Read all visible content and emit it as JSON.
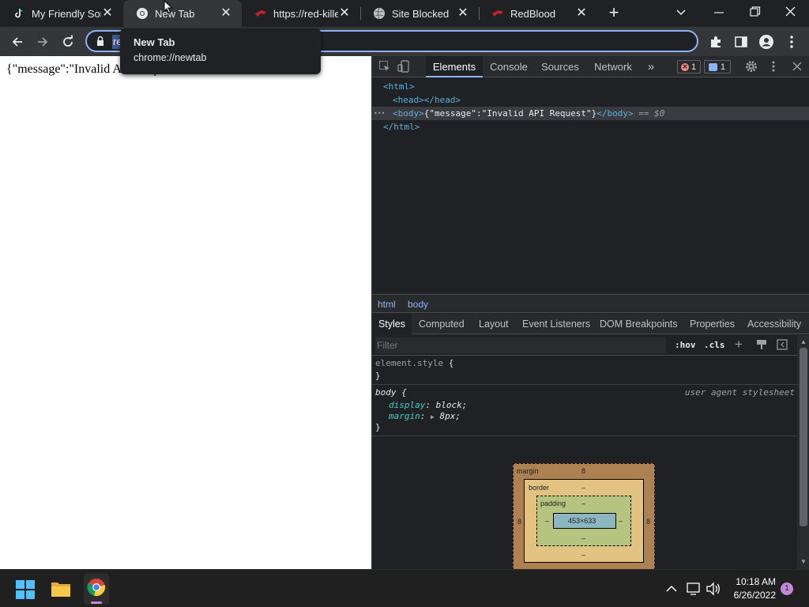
{
  "tabs": [
    {
      "title": "My Friendly Sonnet",
      "icon": "tiktok-icon",
      "active": false
    },
    {
      "title": "New Tab",
      "icon": "chrome-icon",
      "active": true
    },
    {
      "title": "https://red-killer.cab",
      "icon": "redblood-icon",
      "active": false
    },
    {
      "title": "Site Blocked",
      "icon": "globe-icon",
      "active": false
    },
    {
      "title": "RedBlood",
      "icon": "redblood-icon",
      "active": false
    }
  ],
  "new_tab_label": "+",
  "omnibox": {
    "visible_text": "re"
  },
  "tooltip": {
    "title": "New Tab",
    "url": "chrome://newtab"
  },
  "page": {
    "body_text": "{\"message\":\"Invalid API Request\"}"
  },
  "devtools": {
    "tabs": [
      "Elements",
      "Console",
      "Sources",
      "Network"
    ],
    "more_label": "»",
    "error_count": "1",
    "message_count": "1",
    "dom": {
      "html_open": "<html>",
      "head": "<head></head>",
      "body_open": "<body>",
      "body_text": "{\"message\":\"Invalid API Request\"}",
      "body_close": "</body>",
      "eq": "== $0",
      "html_close": "</html>",
      "ellipsis": "•••"
    },
    "breadcrumbs": [
      "html",
      "body"
    ],
    "subtabs": [
      "Styles",
      "Computed",
      "Layout",
      "Event Listeners",
      "DOM Breakpoints",
      "Properties",
      "Accessibility"
    ],
    "filter_placeholder": "Filter",
    "hov": ":hov",
    "cls": ".cls",
    "plus": "+",
    "element_style_selector": "element.style",
    "brace_open": "{",
    "brace_close": "}",
    "body_rule": {
      "selector": "body",
      "source": "user agent stylesheet",
      "props": [
        {
          "name": "display",
          "value": "block;"
        },
        {
          "name": "margin",
          "value": "8px;"
        }
      ]
    },
    "box_model": {
      "margin_label": "margin",
      "margin_top": "8",
      "margin_left": "8",
      "margin_right": "8",
      "border_label": "border",
      "border_value": "–",
      "padding_label": "padding",
      "padding_value": "–",
      "content": "453×633"
    }
  },
  "taskbar": {
    "time": "10:18 AM",
    "date": "6/26/2022",
    "notification_count": "1"
  },
  "colors": {
    "accent": "#8ab4f8",
    "error": "#f28b82",
    "page_bg": "#ffffff"
  }
}
